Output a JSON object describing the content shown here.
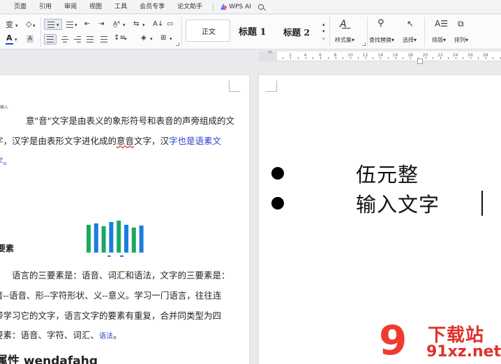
{
  "menu": {
    "tabs": [
      "页面",
      "引用",
      "审阅",
      "视图",
      "工具",
      "会员专享",
      "论文助手"
    ],
    "ai_label": "WPS AI"
  },
  "ribbon": {
    "styles": {
      "normal": "正文",
      "heading1": "标题 1",
      "heading2": "标题 2"
    },
    "style_set_label": "样式集",
    "find_replace_label": "查找替换",
    "select_label": "选择",
    "layout_label": "排版",
    "arrange_label": "排列"
  },
  "ruler": {
    "numbers": [
      "2",
      "4",
      "6",
      "8",
      "10",
      "12",
      "14",
      "16",
      "18",
      "20",
      "22",
      "24",
      "26",
      "28"
    ]
  },
  "left_page": {
    "tiny_note": "输入",
    "p1_line1": "意\"音\"文字是由表义的象形符号和表音的声旁组成的文",
    "p1_line2a": "字，汉字是由表形文字进化成的",
    "p1_line2b": "意音",
    "p1_line2c": "文字，汉",
    "p1_line2d": "字也是语素文",
    "p1_line3": "字。",
    "heading_small": "要素",
    "p2_line1": "语言的三要素是：语音、词汇和语法，文字的三要素是：",
    "p2_line2": "音--语音、形--字符形状、义--意义。学习一门语言，往往连",
    "p2_line3": "带学习它的文字，语言文字的要素有重复，合并同类型为四",
    "p2_line4a": "要素：语音、字符、词汇、",
    "p2_line4b": "语法",
    "p2_line4c": "。",
    "heading_large": "属性 wendafahg"
  },
  "right_page": {
    "bullet1": "伍元整",
    "bullet2": "输入文字"
  },
  "watermark": {
    "chinese": "下载站",
    "url": "91xz.net",
    "nine": "9"
  },
  "chart_data": {
    "type": "bar",
    "series": [
      {
        "values": [
          40,
          42,
          38,
          44,
          46,
          40,
          36,
          39
        ]
      }
    ],
    "colors": [
      "#1aa864",
      "#1a7de0"
    ]
  },
  "colors": {
    "accent": "#2b41c9",
    "watermark": "#e0312b"
  }
}
